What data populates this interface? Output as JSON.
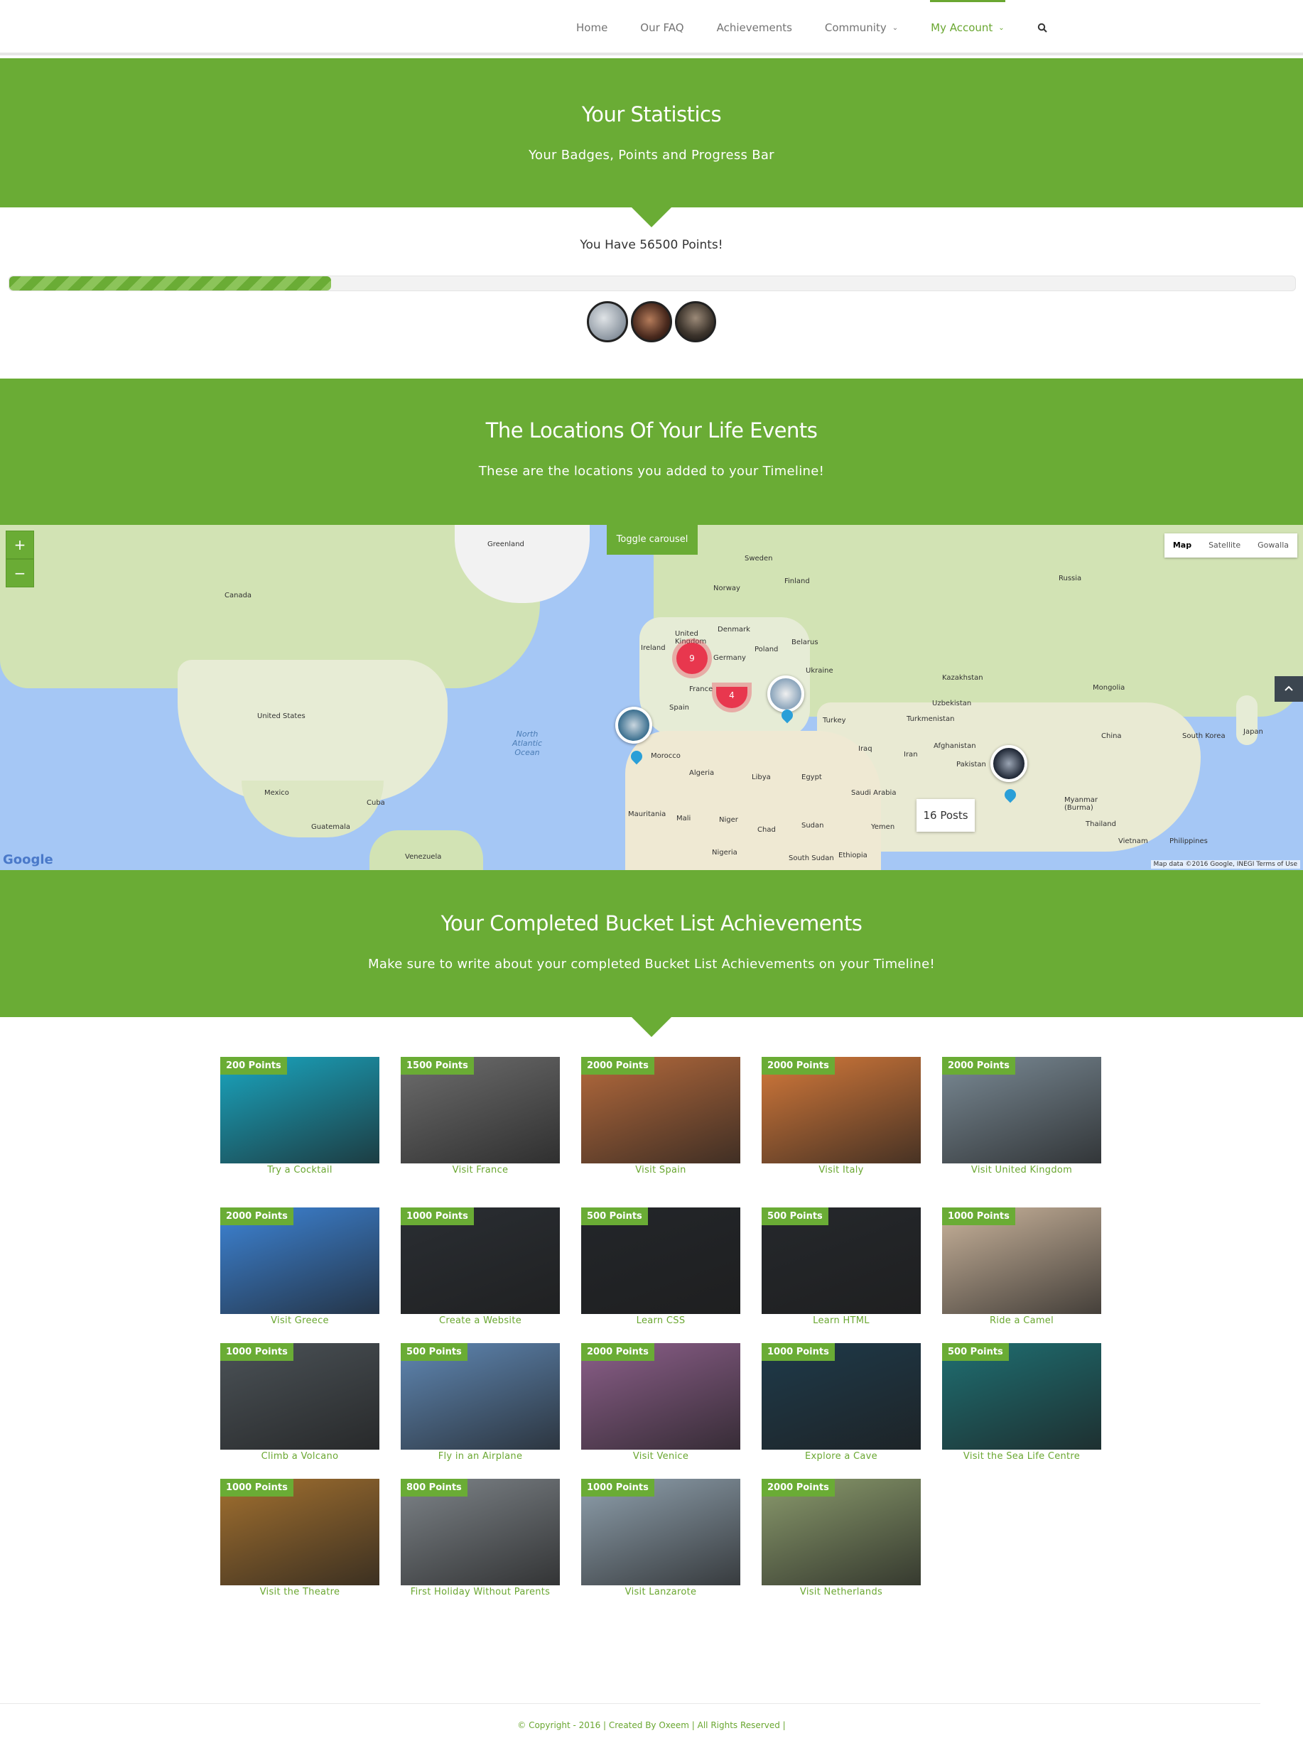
{
  "nav": {
    "items": [
      {
        "label": "Home"
      },
      {
        "label": "Our FAQ"
      },
      {
        "label": "Achievements"
      },
      {
        "label": "Community",
        "caret": "⌄"
      },
      {
        "label": "My Account",
        "caret": "⌄"
      }
    ],
    "active": "My Account",
    "search_icon": "search-icon"
  },
  "stats": {
    "title": "Your Statistics",
    "subtitle": "Your Badges, Points and Progress Bar",
    "points_text": "You Have 56500 Points!",
    "progress_fraction": 0.25,
    "badges": [
      "badge-1",
      "badge-2",
      "badge-3"
    ]
  },
  "locations": {
    "title": "The Locations Of Your Life Events",
    "subtitle": "These are the locations you added to your Timeline!"
  },
  "map": {
    "zoom_in": "+",
    "zoom_out": "−",
    "toggle": "Toggle carousel",
    "types": [
      "Map",
      "Satellite",
      "Gowalla"
    ],
    "selected_type": "Map",
    "posts_popup": "16 Posts",
    "cluster_1": "9",
    "cluster_2": "4",
    "google": "Google",
    "attribution": "Map data ©2016 Google, INEGI   Terms of Use",
    "labels": {
      "greenland": "Greenland",
      "canada": "Canada",
      "us": "United States",
      "mexico": "Mexico",
      "sweden": "Sweden",
      "finland": "Finland",
      "norway": "Norway",
      "russia": "Russia",
      "uk": "United Kingdom",
      "ireland": "Ireland",
      "denmark": "Denmark",
      "poland": "Poland",
      "belarus": "Belarus",
      "ukraine": "Ukraine",
      "germany": "Germany",
      "france": "France",
      "spain": "Spain",
      "kazakhstan": "Kazakhstan",
      "mongolia": "Mongolia",
      "china": "China",
      "turkey": "Turkey",
      "iran": "Iran",
      "iraq": "Iraq",
      "afghanistan": "Afghanistan",
      "pakistan": "Pakistan",
      "algeria": "Algeria",
      "libya": "Libya",
      "egypt": "Egypt",
      "morocco": "Morocco",
      "saudi": "Saudi Arabia",
      "mali": "Mali",
      "niger": "Niger",
      "chad": "Chad",
      "sudan": "Sudan",
      "nigeria": "Nigeria",
      "ethiopia": "Ethiopia",
      "south_sudan": "South Sudan",
      "yemen": "Yemen",
      "myanmar": "Myanmar (Burma)",
      "thailand": "Thailand",
      "vietnam": "Vietnam",
      "philippines": "Philippines",
      "south_korea": "South Korea",
      "japan": "Japan",
      "uzbekistan": "Uzbekistan",
      "turkmenistan": "Turkmenistan",
      "mauritania": "Mauritania",
      "venezuela": "Venezuela",
      "north_atlantic": "North Atlantic Ocean",
      "cuba": "Cuba",
      "guatemala": "Guatemala"
    }
  },
  "bucket": {
    "title": "Your Completed Bucket List Achievements",
    "subtitle": "Make sure to write about your completed Bucket List Achievements on your Timeline!",
    "items": [
      {
        "points": "200 Points",
        "caption": "Try a Cocktail",
        "color": "#1aa6c0"
      },
      {
        "points": "1500 Points",
        "caption": "Visit France",
        "color": "#6d6d6d"
      },
      {
        "points": "2000 Points",
        "caption": "Visit Spain",
        "color": "#b56a3c"
      },
      {
        "points": "2000 Points",
        "caption": "Visit Italy",
        "color": "#d4793a"
      },
      {
        "points": "2000 Points",
        "caption": "Visit United Kingdom",
        "color": "#7a8a95"
      },
      {
        "points": "2000 Points",
        "caption": "Visit Greece",
        "color": "#3d84d6"
      },
      {
        "points": "1000 Points",
        "caption": "Create a Website",
        "color": "#2a2e33"
      },
      {
        "points": "500 Points",
        "caption": "Learn CSS",
        "color": "#23262a"
      },
      {
        "points": "500 Points",
        "caption": "Learn HTML",
        "color": "#25282c"
      },
      {
        "points": "1000 Points",
        "caption": "Ride a Camel",
        "color": "#c9b39b"
      },
      {
        "points": "1000 Points",
        "caption": "Climb a Volcano",
        "color": "#4b5257"
      },
      {
        "points": "500 Points",
        "caption": "Fly in an Airplane",
        "color": "#5f87b3"
      },
      {
        "points": "2000 Points",
        "caption": "Visit Venice",
        "color": "#8c5f8a"
      },
      {
        "points": "1000 Points",
        "caption": "Explore a Cave",
        "color": "#1e3a4a"
      },
      {
        "points": "500 Points",
        "caption": "Visit the Sea Life Centre",
        "color": "#1f6f72"
      },
      {
        "points": "1000 Points",
        "caption": "Visit the Theatre",
        "color": "#a2702f"
      },
      {
        "points": "800 Points",
        "caption": "First Holiday Without Parents",
        "color": "#7d8388"
      },
      {
        "points": "1000 Points",
        "caption": "Visit Lanzarote",
        "color": "#8fa0ad"
      },
      {
        "points": "2000 Points",
        "caption": "Visit Netherlands",
        "color": "#8a9a6c"
      }
    ]
  },
  "footer": {
    "text": "© Copyright - 2016 | Created By Oxeem | All Rights Reserved |"
  }
}
